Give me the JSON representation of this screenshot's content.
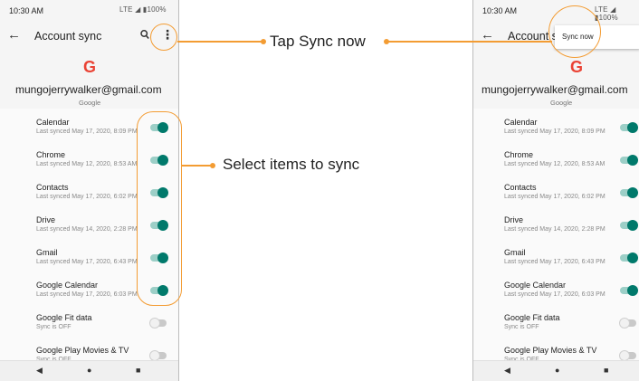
{
  "status": {
    "time": "10:30 AM",
    "system": "LTE ◢ ▮100%"
  },
  "appbar": {
    "title": "Account sync"
  },
  "account": {
    "email": "mungojerrywalker@gmail.com",
    "provider": "Google"
  },
  "menu": {
    "sync_now": "Sync now"
  },
  "items": [
    {
      "name": "Calendar",
      "sub": "Last synced May 17, 2020, 8:09 PM",
      "on": true
    },
    {
      "name": "Chrome",
      "sub": "Last synced May 12, 2020, 8:53 AM",
      "on": true
    },
    {
      "name": "Contacts",
      "sub": "Last synced May 17, 2020, 6:02 PM",
      "on": true
    },
    {
      "name": "Drive",
      "sub": "Last synced May 14, 2020, 2:28 PM",
      "on": true
    },
    {
      "name": "Gmail",
      "sub": "Last synced May 17, 2020, 6:43 PM",
      "on": true
    },
    {
      "name": "Google Calendar",
      "sub": "Last synced May 17, 2020, 6:03 PM",
      "on": true
    },
    {
      "name": "Google Fit data",
      "sub": "Sync is OFF",
      "on": false
    },
    {
      "name": "Google Play Movies & TV",
      "sub": "Sync is OFF",
      "on": false
    }
  ],
  "callouts": {
    "tap_sync": "Tap Sync now",
    "select_items": "Select items to sync"
  },
  "accent_color": "#f39c33",
  "toggle_on_color": "#00796b",
  "icons": [
    "back-arrow-icon",
    "search-icon",
    "more-vert-icon",
    "google-g-icon",
    "nav-back-icon",
    "nav-home-icon",
    "nav-recents-icon"
  ]
}
